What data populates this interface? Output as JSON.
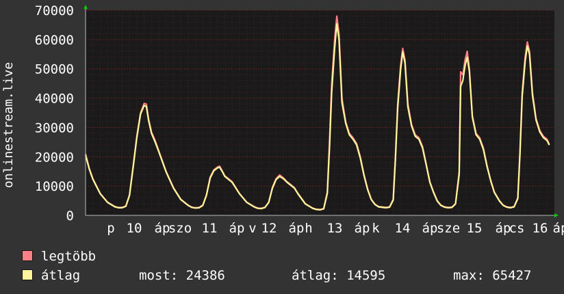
{
  "chart_data": {
    "type": "line",
    "ylabel": "onlinestream.live",
    "ylim": [
      0,
      70000
    ],
    "yticks": [
      0,
      10000,
      20000,
      30000,
      40000,
      50000,
      60000,
      70000
    ],
    "ytick_labels": [
      "0",
      "10000",
      "20000",
      "30000",
      "40000",
      "50000",
      "60000",
      "70000"
    ],
    "xtick_labels": [
      "p",
      "10",
      "áp",
      "szo",
      "11",
      "áp",
      "v",
      "12",
      "áp",
      "h",
      "13",
      "áp",
      "k",
      "14",
      "áp",
      "sze",
      "15",
      "áp",
      "cs",
      "16",
      "áp"
    ],
    "grid": true,
    "background": "#1a1a1a",
    "grid_color": "#6b2020",
    "series": [
      {
        "name": "legtöbb",
        "color": "#ff7f86",
        "points": [
          [
            0,
            21000
          ],
          [
            0.5,
            16000
          ],
          [
            1,
            12500
          ],
          [
            1.5,
            10000
          ],
          [
            2,
            7500
          ],
          [
            3,
            4500
          ],
          [
            4,
            3000
          ],
          [
            4.5,
            2700
          ],
          [
            5,
            2700
          ],
          [
            5.5,
            3200
          ],
          [
            6,
            7000
          ],
          [
            6.5,
            17000
          ],
          [
            7,
            27000
          ],
          [
            7.5,
            35000
          ],
          [
            8,
            38200
          ],
          [
            8.3,
            38000
          ],
          [
            8.6,
            33000
          ],
          [
            9,
            28500
          ],
          [
            9.5,
            25500
          ],
          [
            10,
            22000
          ],
          [
            11,
            15000
          ],
          [
            12,
            9500
          ],
          [
            13,
            5500
          ],
          [
            14,
            3500
          ],
          [
            14.5,
            2800
          ],
          [
            15,
            2600
          ],
          [
            15.5,
            2700
          ],
          [
            16,
            3500
          ],
          [
            16.5,
            7000
          ],
          [
            17,
            13000
          ],
          [
            17.5,
            15500
          ],
          [
            18,
            16500
          ],
          [
            18.3,
            16800
          ],
          [
            18.7,
            15000
          ],
          [
            19,
            13500
          ],
          [
            19.5,
            12500
          ],
          [
            20,
            11500
          ],
          [
            21,
            7500
          ],
          [
            22,
            4500
          ],
          [
            23,
            3000
          ],
          [
            23.5,
            2500
          ],
          [
            24,
            2400
          ],
          [
            24.5,
            2800
          ],
          [
            25,
            4500
          ],
          [
            25.5,
            9500
          ],
          [
            26,
            12500
          ],
          [
            26.5,
            13800
          ],
          [
            27,
            12800
          ],
          [
            27.5,
            11500
          ],
          [
            28,
            10500
          ],
          [
            28.5,
            9500
          ],
          [
            29,
            7500
          ],
          [
            30,
            4000
          ],
          [
            31,
            2500
          ],
          [
            31.5,
            2100
          ],
          [
            32,
            2000
          ],
          [
            32.5,
            2300
          ],
          [
            33,
            8000
          ],
          [
            33.3,
            25000
          ],
          [
            33.6,
            45000
          ],
          [
            34,
            60000
          ],
          [
            34.3,
            68000
          ],
          [
            34.6,
            62000
          ],
          [
            35,
            40000
          ],
          [
            35.5,
            32000
          ],
          [
            36,
            28000
          ],
          [
            36.5,
            26500
          ],
          [
            37,
            24500
          ],
          [
            37.5,
            20000
          ],
          [
            38,
            14000
          ],
          [
            38.5,
            9000
          ],
          [
            39,
            5500
          ],
          [
            39.5,
            3800
          ],
          [
            40,
            3000
          ],
          [
            41,
            2700
          ],
          [
            41.5,
            2900
          ],
          [
            42,
            5500
          ],
          [
            42.3,
            20000
          ],
          [
            42.6,
            38000
          ],
          [
            43,
            51000
          ],
          [
            43.3,
            57000
          ],
          [
            43.6,
            53000
          ],
          [
            44,
            38000
          ],
          [
            44.5,
            31000
          ],
          [
            45,
            27500
          ],
          [
            45.5,
            26500
          ],
          [
            46,
            23500
          ],
          [
            46.5,
            17500
          ],
          [
            47,
            11500
          ],
          [
            47.5,
            8000
          ],
          [
            48,
            5000
          ],
          [
            48.5,
            3500
          ],
          [
            49,
            2900
          ],
          [
            49.5,
            2700
          ],
          [
            50,
            2800
          ],
          [
            50.5,
            4000
          ],
          [
            51,
            15000
          ],
          [
            51.2,
            49000
          ],
          [
            51.5,
            48000
          ],
          [
            51.8,
            53000
          ],
          [
            52.1,
            56000
          ],
          [
            52.4,
            50000
          ],
          [
            52.8,
            34000
          ],
          [
            53.3,
            28000
          ],
          [
            53.8,
            26500
          ],
          [
            54.3,
            23000
          ],
          [
            54.8,
            17000
          ],
          [
            55.3,
            12000
          ],
          [
            55.8,
            8000
          ],
          [
            56.5,
            5000
          ],
          [
            57,
            3500
          ],
          [
            57.5,
            2900
          ],
          [
            58,
            2700
          ],
          [
            58.5,
            3000
          ],
          [
            59,
            6000
          ],
          [
            59.3,
            22000
          ],
          [
            59.6,
            42000
          ],
          [
            60,
            54000
          ],
          [
            60.3,
            59200
          ],
          [
            60.6,
            56000
          ],
          [
            61,
            42000
          ],
          [
            61.5,
            33000
          ],
          [
            62,
            29000
          ],
          [
            62.5,
            27000
          ],
          [
            63,
            26000
          ],
          [
            63.3,
            24200
          ]
        ]
      },
      {
        "name": "átlag",
        "color": "#fff59a",
        "points": [
          [
            0,
            20500
          ],
          [
            0.5,
            15800
          ],
          [
            1,
            12300
          ],
          [
            1.5,
            9800
          ],
          [
            2,
            7400
          ],
          [
            3,
            4400
          ],
          [
            4,
            2900
          ],
          [
            4.5,
            2600
          ],
          [
            5,
            2600
          ],
          [
            5.5,
            3100
          ],
          [
            6,
            6800
          ],
          [
            6.5,
            16500
          ],
          [
            7,
            26500
          ],
          [
            7.5,
            34500
          ],
          [
            8,
            37500
          ],
          [
            8.3,
            37200
          ],
          [
            8.6,
            32500
          ],
          [
            9,
            28000
          ],
          [
            9.5,
            25000
          ],
          [
            10,
            21700
          ],
          [
            11,
            14800
          ],
          [
            12,
            9300
          ],
          [
            13,
            5400
          ],
          [
            14,
            3400
          ],
          [
            14.5,
            2700
          ],
          [
            15,
            2500
          ],
          [
            15.5,
            2600
          ],
          [
            16,
            3400
          ],
          [
            16.5,
            6800
          ],
          [
            17,
            12700
          ],
          [
            17.5,
            15200
          ],
          [
            18,
            16200
          ],
          [
            18.3,
            16400
          ],
          [
            18.7,
            14800
          ],
          [
            19,
            13300
          ],
          [
            19.5,
            12300
          ],
          [
            20,
            11300
          ],
          [
            21,
            7400
          ],
          [
            22,
            4400
          ],
          [
            23,
            2900
          ],
          [
            23.5,
            2400
          ],
          [
            24,
            2300
          ],
          [
            24.5,
            2700
          ],
          [
            25,
            4400
          ],
          [
            25.5,
            9200
          ],
          [
            26,
            12200
          ],
          [
            26.5,
            13300
          ],
          [
            27,
            12500
          ],
          [
            27.5,
            11300
          ],
          [
            28,
            10300
          ],
          [
            28.5,
            9300
          ],
          [
            29,
            7300
          ],
          [
            30,
            3900
          ],
          [
            31,
            2400
          ],
          [
            31.5,
            2000
          ],
          [
            32,
            1900
          ],
          [
            32.5,
            2200
          ],
          [
            33,
            7500
          ],
          [
            33.3,
            23000
          ],
          [
            33.6,
            42000
          ],
          [
            34,
            57000
          ],
          [
            34.3,
            65400
          ],
          [
            34.6,
            60000
          ],
          [
            35,
            38500
          ],
          [
            35.5,
            31500
          ],
          [
            36,
            27500
          ],
          [
            36.5,
            26000
          ],
          [
            37,
            24000
          ],
          [
            37.5,
            19500
          ],
          [
            38,
            13700
          ],
          [
            38.5,
            8800
          ],
          [
            39,
            5400
          ],
          [
            39.5,
            3700
          ],
          [
            40,
            2900
          ],
          [
            41,
            2600
          ],
          [
            41.5,
            2800
          ],
          [
            42,
            5200
          ],
          [
            42.3,
            19000
          ],
          [
            42.6,
            36500
          ],
          [
            43,
            49500
          ],
          [
            43.3,
            55800
          ],
          [
            43.6,
            52000
          ],
          [
            44,
            37000
          ],
          [
            44.5,
            30500
          ],
          [
            45,
            27000
          ],
          [
            45.5,
            26000
          ],
          [
            46,
            23000
          ],
          [
            46.5,
            17200
          ],
          [
            47,
            11300
          ],
          [
            47.5,
            7800
          ],
          [
            48,
            4900
          ],
          [
            48.5,
            3400
          ],
          [
            49,
            2800
          ],
          [
            49.5,
            2600
          ],
          [
            50,
            2700
          ],
          [
            50.5,
            3900
          ],
          [
            51,
            14000
          ],
          [
            51.2,
            44000
          ],
          [
            51.5,
            46000
          ],
          [
            51.8,
            51000
          ],
          [
            52.1,
            54000
          ],
          [
            52.4,
            49000
          ],
          [
            52.8,
            33500
          ],
          [
            53.3,
            27500
          ],
          [
            53.8,
            26000
          ],
          [
            54.3,
            22500
          ],
          [
            54.8,
            16700
          ],
          [
            55.3,
            11800
          ],
          [
            55.8,
            7800
          ],
          [
            56.5,
            4900
          ],
          [
            57,
            3400
          ],
          [
            57.5,
            2800
          ],
          [
            58,
            2600
          ],
          [
            58.5,
            2900
          ],
          [
            59,
            5700
          ],
          [
            59.3,
            21000
          ],
          [
            59.6,
            40500
          ],
          [
            60,
            52500
          ],
          [
            60.3,
            57800
          ],
          [
            60.6,
            55000
          ],
          [
            61,
            41000
          ],
          [
            61.5,
            32500
          ],
          [
            62,
            28500
          ],
          [
            62.5,
            26500
          ],
          [
            63,
            25500
          ],
          [
            63.3,
            24000
          ]
        ]
      }
    ]
  },
  "legend": [
    {
      "label": "legtöbb",
      "color": "#ff7f86"
    },
    {
      "label": "átlag",
      "color": "#fff59a"
    }
  ],
  "stats": {
    "most": "most: 24386",
    "atlag": "átlag: 14595",
    "max": "max: 65427"
  }
}
